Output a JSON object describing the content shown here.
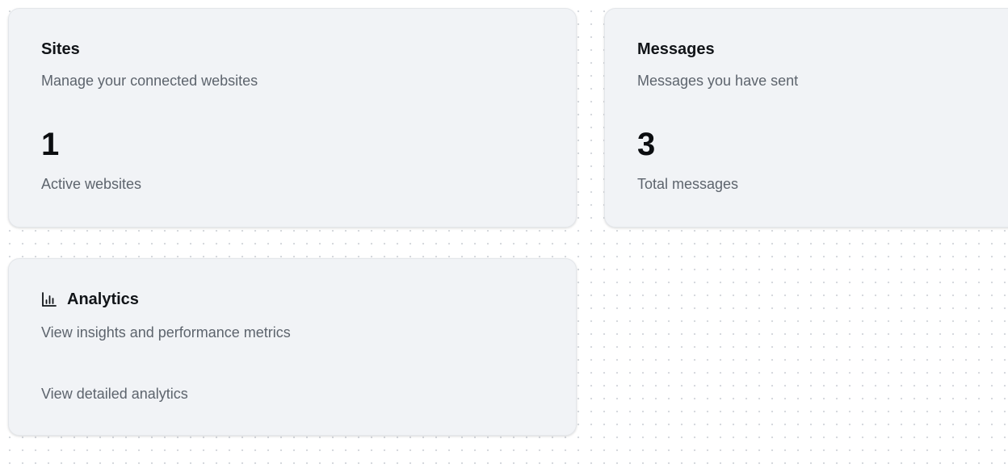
{
  "cards": {
    "sites": {
      "title": "Sites",
      "subtitle": "Manage your connected websites",
      "value": "1",
      "caption": "Active websites"
    },
    "messages": {
      "title": "Messages",
      "subtitle": "Messages you have sent",
      "value": "3",
      "caption": "Total messages"
    },
    "analytics": {
      "title": "Analytics",
      "subtitle": "View insights and performance metrics",
      "link": "View detailed analytics",
      "icon": "bar-chart-icon"
    }
  },
  "colors": {
    "card_background": "#f1f3f6",
    "heading": "#111418",
    "muted_text": "#5d646d",
    "dot_grid": "#d4d7dc"
  }
}
